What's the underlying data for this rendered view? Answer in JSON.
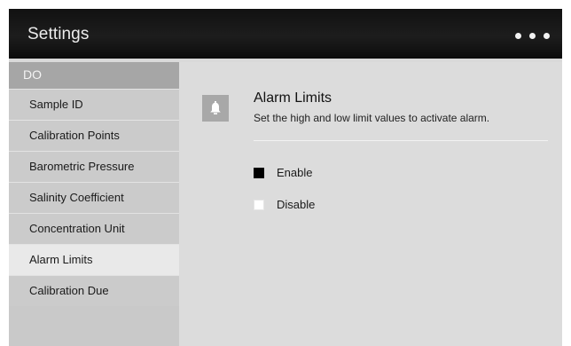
{
  "header": {
    "title": "Settings",
    "menu_icon": "more-dots-icon"
  },
  "sidebar": {
    "section_label": "DO",
    "items": [
      {
        "label": "Sample ID",
        "active": false
      },
      {
        "label": "Calibration Points",
        "active": false
      },
      {
        "label": "Barometric Pressure",
        "active": false
      },
      {
        "label": "Salinity Coefficient",
        "active": false
      },
      {
        "label": "Concentration Unit",
        "active": false
      },
      {
        "label": "Alarm Limits",
        "active": true
      },
      {
        "label": "Calibration Due",
        "active": false
      }
    ]
  },
  "main": {
    "icon": "bell-icon",
    "title": "Alarm Limits",
    "description": "Set the high and low limit values to activate alarm.",
    "options": [
      {
        "label": "Enable",
        "checked": true
      },
      {
        "label": "Disable",
        "checked": false
      }
    ]
  },
  "colors": {
    "titlebar": "#111111",
    "sidebar": "#c9c9c9",
    "sidebar_active": "#e9e9e9",
    "section_header": "#a6a6a6",
    "content": "#dcdcdc"
  }
}
